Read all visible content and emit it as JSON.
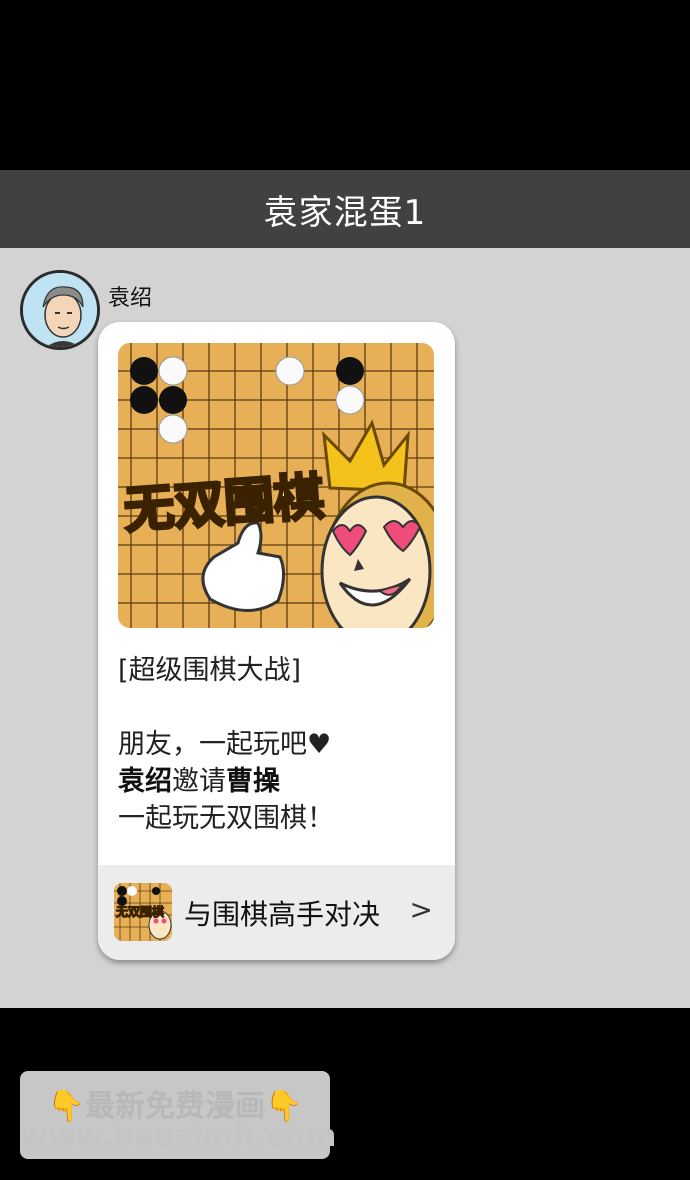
{
  "header": {
    "title": "袁家混蛋1"
  },
  "message": {
    "sender": "袁绍",
    "card": {
      "game_title_art": "无双围棋",
      "tag": "[超级围棋大战]",
      "line1": "朋友，一起玩吧♥",
      "inviter": "袁绍",
      "invite_word": "邀请",
      "invitee": "曹操",
      "line3": "一起玩无双围棋！",
      "footer_label": "与围棋高手对决",
      "footer_arrow": ">",
      "footer_icon_text": "无双围棋"
    }
  },
  "watermark": {
    "line1": "最新免费漫画",
    "line2": "www.baozimh.com",
    "emoji": "👇"
  },
  "colors": {
    "header_bg": "#414141",
    "chat_bg": "#d3d3d3",
    "board": "#e8b056",
    "footer_bg": "#ececec"
  }
}
